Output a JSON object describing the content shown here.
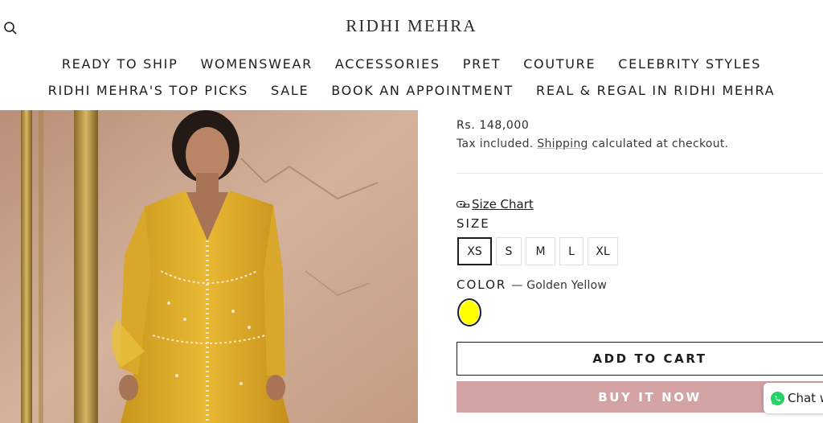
{
  "brand": {
    "name": "RIDHI MEHRA"
  },
  "icons": {
    "search": "search-icon",
    "size_chart": "measuring-tape-icon",
    "chat": "whatsapp-icon"
  },
  "nav": {
    "row1": [
      "READY TO SHIP",
      "WOMENSWEAR",
      "ACCESSORIES",
      "PRET",
      "COUTURE",
      "CELEBRITY STYLES"
    ],
    "row2": [
      "RIDHI MEHRA'S TOP PICKS",
      "SALE",
      "BOOK AN APPOINTMENT",
      "REAL & REGAL IN RIDHI MEHRA"
    ]
  },
  "product": {
    "price": "Rs. 148,000",
    "tax_prefix": "Tax included. ",
    "tax_link": "Shipping",
    "tax_suffix": " calculated at checkout.",
    "size_chart_label": "Size Chart",
    "size_label": "SIZE",
    "sizes": [
      "XS",
      "S",
      "M",
      "L",
      "XL"
    ],
    "selected_size": "XS",
    "color_label": "COLOR",
    "color_value": "— Golden Yellow",
    "swatch_color": "#ffff00",
    "add_to_cart": "ADD TO CART",
    "buy_now": "BUY IT NOW"
  },
  "chat": {
    "label": "Chat w"
  },
  "colors": {
    "buy_button": "#d4a3a3",
    "text": "#1c1d1d"
  }
}
